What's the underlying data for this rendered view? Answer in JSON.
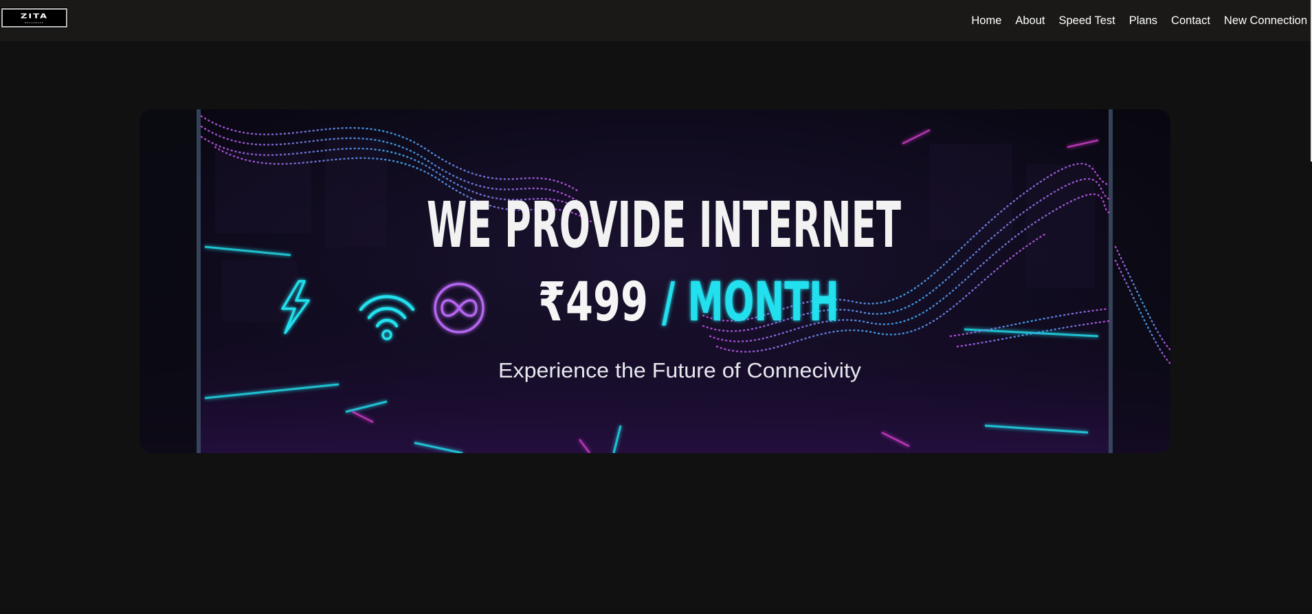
{
  "brand": {
    "logo_word": "ZITA",
    "logo_sub": "BROADBAND"
  },
  "nav": {
    "items": [
      {
        "label": "Home"
      },
      {
        "label": "About"
      },
      {
        "label": "Speed Test"
      },
      {
        "label": "Plans"
      },
      {
        "label": "Contact"
      },
      {
        "label": "New Connection"
      }
    ]
  },
  "banner": {
    "headline": "WE PROVIDE INTERNET",
    "price": "₹499",
    "period": "/ MONTH",
    "tagline": "Experience the Future of Connecivity",
    "icons": [
      "lightning-icon",
      "wifi-icon",
      "infinity-icon"
    ]
  },
  "colors": {
    "page_bg": "#111111",
    "nav_bg": "#1a1917",
    "accent_cyan": "#22e0ee",
    "accent_purple": "#b566f0",
    "accent_magenta": "#e040d8"
  }
}
